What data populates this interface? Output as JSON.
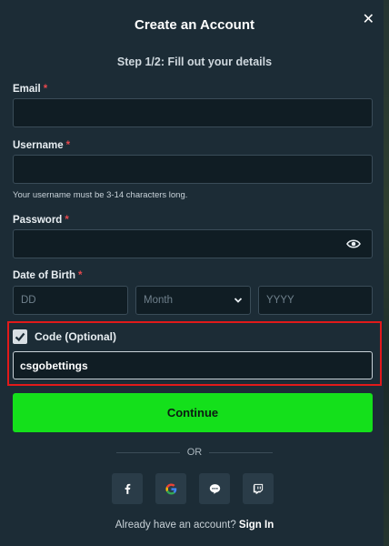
{
  "modal": {
    "title": "Create an Account",
    "close_symbol": "✕",
    "subtitle": "Step 1/2: Fill out your details"
  },
  "fields": {
    "email": {
      "label": "Email",
      "required": "*",
      "value": ""
    },
    "username": {
      "label": "Username",
      "required": "*",
      "value": "",
      "hint": "Your username must be 3-14 characters long."
    },
    "password": {
      "label": "Password",
      "required": "*",
      "value": "",
      "icon": "eye-icon"
    },
    "dob": {
      "label": "Date of Birth",
      "required": "*",
      "day_placeholder": "DD",
      "month_selected": "Month",
      "year_placeholder": "YYYY"
    },
    "code": {
      "label": "Code (Optional)",
      "checked": true,
      "value": "csgobettings"
    }
  },
  "actions": {
    "continue_label": "Continue",
    "or_label": "OR",
    "social": [
      {
        "name": "facebook-icon",
        "glyph": "f"
      },
      {
        "name": "google-icon",
        "glyph": "G"
      },
      {
        "name": "line-chat-icon",
        "glyph": ""
      },
      {
        "name": "twitch-icon",
        "glyph": ""
      }
    ],
    "signin_prompt": "Already have an account?",
    "signin_link": "Sign In"
  },
  "colors": {
    "background": "#1c2c36",
    "input_bg": "#101d24",
    "accent_green": "#14e01b",
    "required_red": "#e5484d",
    "highlight_red": "#e11a1a"
  }
}
